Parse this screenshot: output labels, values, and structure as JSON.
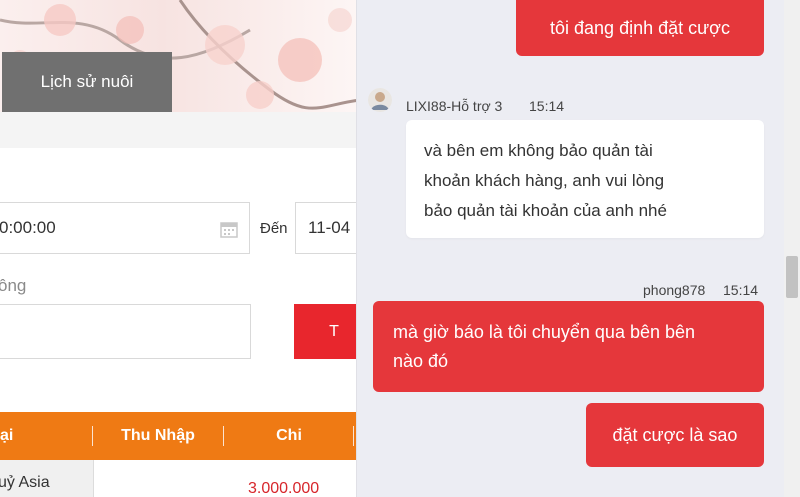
{
  "background_page": {
    "history_button": "Lịch sử nuôi",
    "from_date_value": "0:00:00",
    "to_label": "Đến",
    "to_date_value": "11-04",
    "status_label": "ông",
    "search_button": "T",
    "table_headers": [
      "ại",
      "Thu Nhập",
      "Chi",
      ""
    ],
    "row": {
      "col1": "uỷ Asia",
      "col3": "3.000.000"
    }
  },
  "chat": {
    "messages": [
      {
        "sender": "user",
        "text": "tôi đang định đặt cược"
      },
      {
        "sender": "agent",
        "name": "LIXI88-Hỗ trợ 3",
        "time": "15:14",
        "lines": [
          "và bên em không bảo quản tài",
          "khoản khách hàng, anh vui lòng",
          "bảo quản tài khoản của anh nhé"
        ]
      },
      {
        "sender": "user",
        "name": "phong878",
        "time": "15:14",
        "lines": [
          "mà giờ báo là tôi chuyển qua bên bên",
          "nào đó"
        ]
      },
      {
        "sender": "user",
        "text": "đặt cược là sao"
      }
    ]
  },
  "colors": {
    "accent_red": "#e5373b",
    "table_orange": "#ef7a14",
    "chat_bg": "#ecedf3"
  }
}
